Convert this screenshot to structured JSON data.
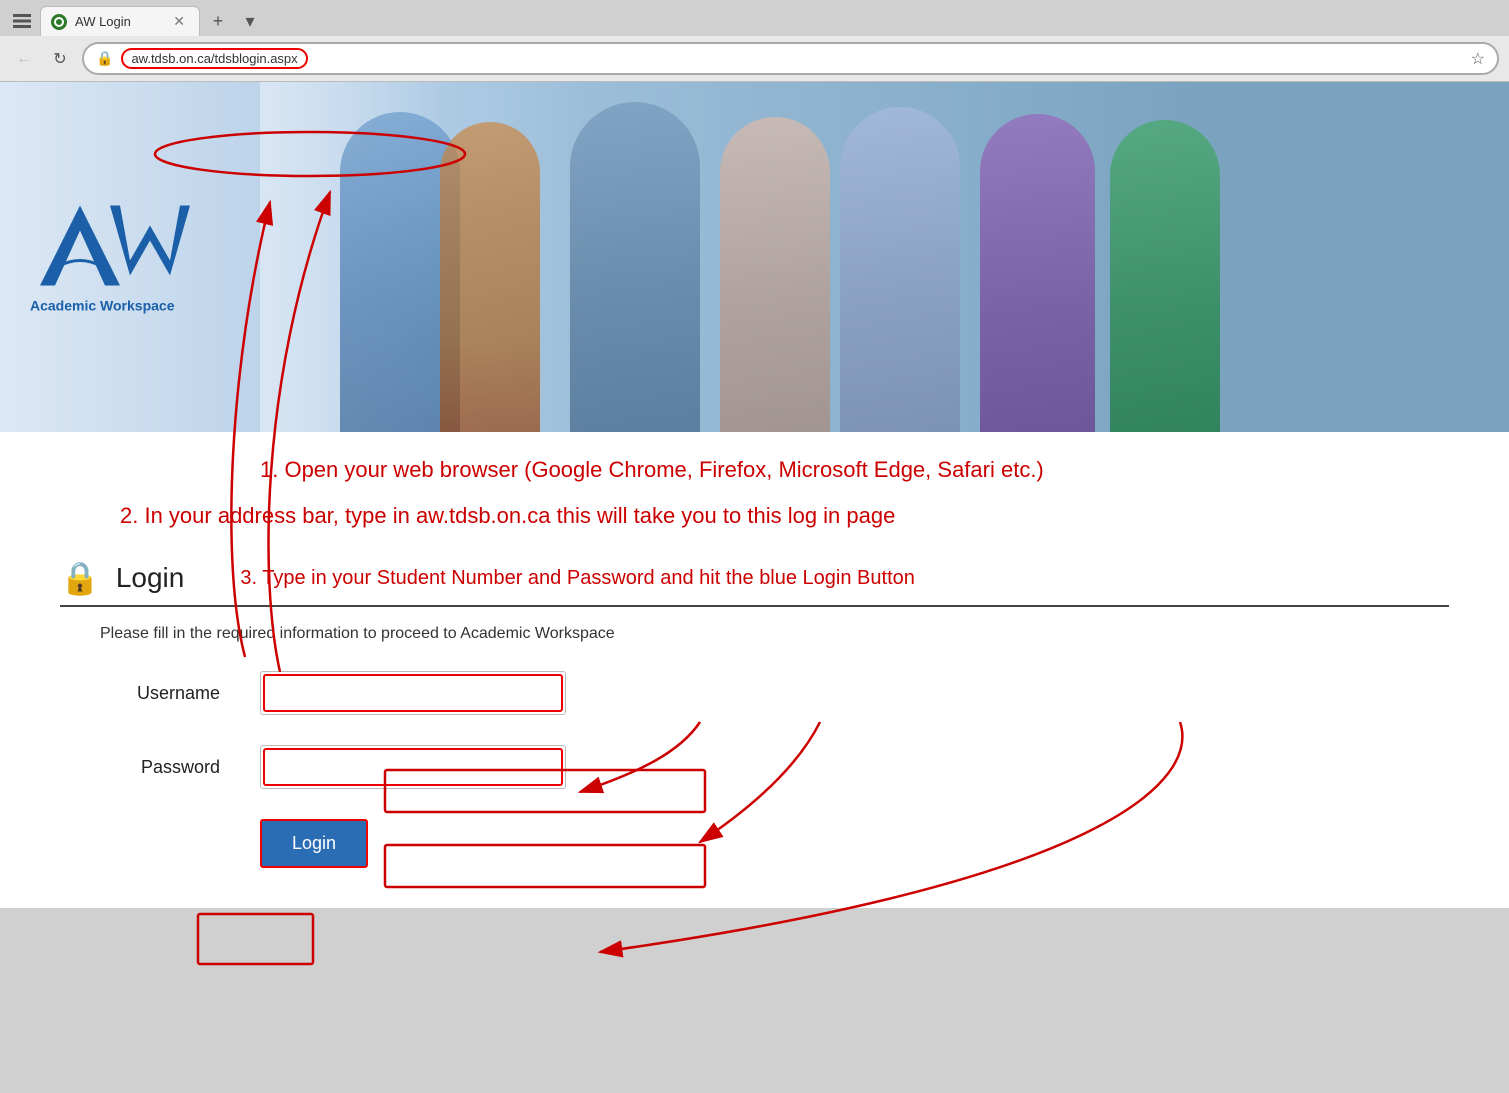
{
  "browser": {
    "tab_title": "AW Login",
    "url": "aw.tdsb.on.ca/tdsblogin.aspx",
    "new_tab_label": "+",
    "dropdown_label": "▾"
  },
  "logo": {
    "text": "AW",
    "subtitle": "Academic Workspace"
  },
  "instructions": {
    "step1": "1. Open your web browser (Google Chrome, Firefox, Microsoft Edge, Safari etc.)",
    "step2": "2. In your address bar, type in   aw.tdsb.on.ca   this will take you to this log in page",
    "step3": "3. Type in your Student Number and Password and hit the blue Login Button"
  },
  "login_form": {
    "title": "Login",
    "description": "Please fill in the required information to proceed to Academic Workspace",
    "username_label": "Username",
    "password_label": "Password",
    "username_value": "",
    "password_value": "",
    "username_placeholder": "",
    "password_placeholder": "",
    "login_button": "Login"
  }
}
